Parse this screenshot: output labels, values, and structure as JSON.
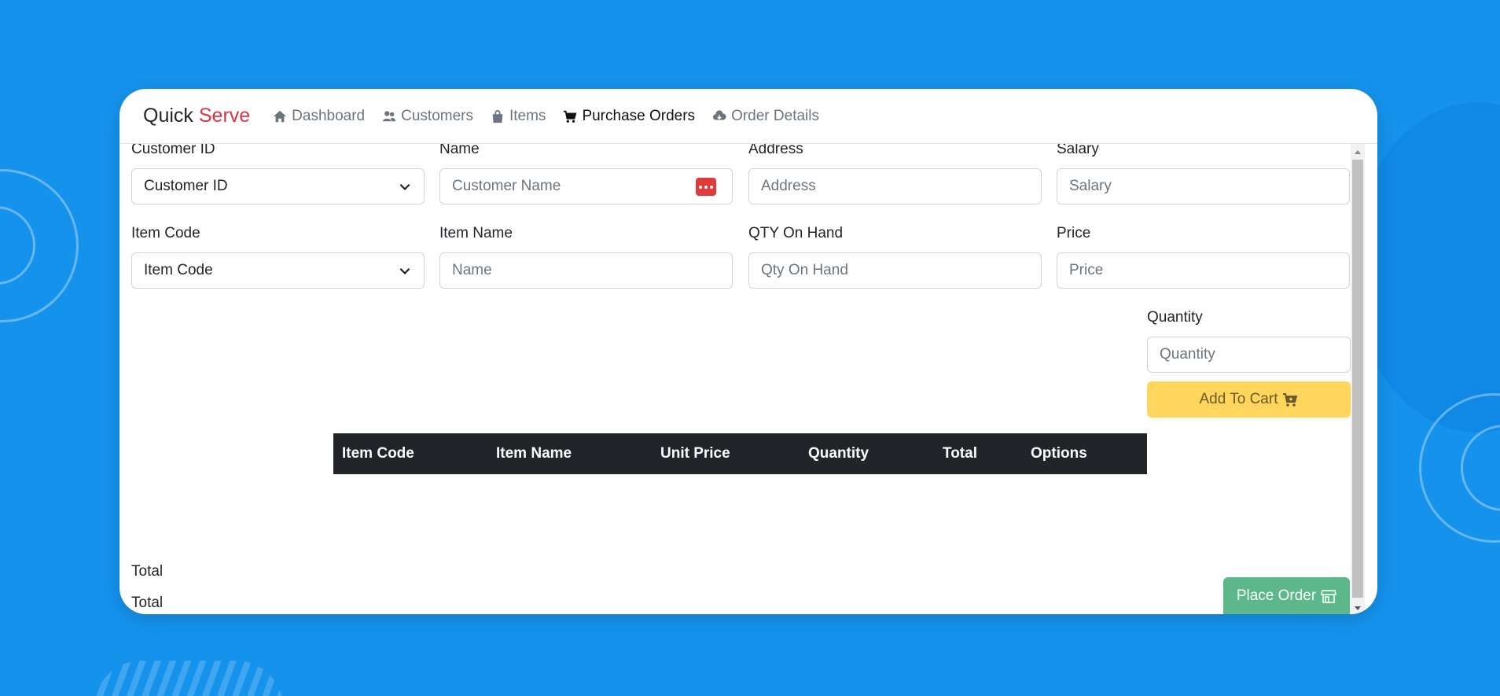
{
  "brand": {
    "part1": "Quick",
    "part2": "Serve"
  },
  "nav": [
    {
      "label": "Dashboard",
      "icon": "home-icon",
      "active": false
    },
    {
      "label": "Customers",
      "icon": "users-icon",
      "active": false
    },
    {
      "label": "Items",
      "icon": "bag-icon",
      "active": false
    },
    {
      "label": "Purchase Orders",
      "icon": "cart-icon",
      "active": true
    },
    {
      "label": "Order Details",
      "icon": "cloud-download-icon",
      "active": false
    }
  ],
  "customer": {
    "id_label": "Customer ID",
    "id_selected": "Customer ID",
    "name_label": "Name",
    "name_placeholder": "Customer Name",
    "address_label": "Address",
    "address_placeholder": "Address",
    "salary_label": "Salary",
    "salary_placeholder": "Salary"
  },
  "item": {
    "code_label": "Item Code",
    "code_selected": "Item Code",
    "name_label": "Item Name",
    "name_placeholder": "Name",
    "qty_label": "QTY On Hand",
    "qty_placeholder": "Qty On Hand",
    "price_label": "Price",
    "price_placeholder": "Price"
  },
  "quantity": {
    "label": "Quantity",
    "placeholder": "Quantity"
  },
  "add_to_cart": "Add To Cart",
  "table": {
    "headers": [
      "Item Code",
      "Item Name",
      "Unit Price",
      "Quantity",
      "Total",
      "Options"
    ]
  },
  "totals": {
    "label1": "Total",
    "label2": "Total"
  },
  "place_order": "Place Order",
  "colors": {
    "background": "#1592ec",
    "brand_accent": "#dc3545",
    "cart_button": "#ffd55b",
    "order_button": "#5cb88a",
    "table_header": "#212529"
  }
}
